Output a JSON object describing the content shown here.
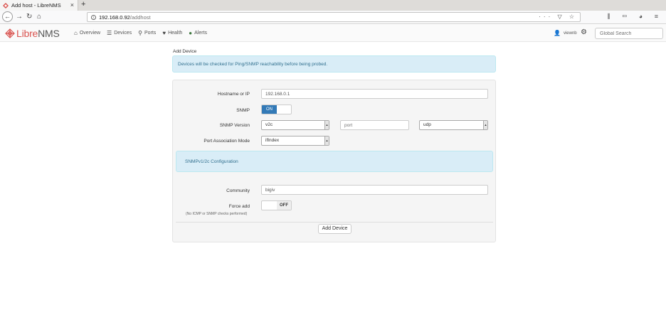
{
  "browser": {
    "tab_title": "Add host - LibreNMS",
    "url_host": "192.168.0.92",
    "url_path": "/addhost",
    "new_tab": "+",
    "url_actions": "··· ▽ ☆",
    "toolbar_icons": "⫼ ▭ ◕ ≡"
  },
  "app": {
    "logo_text": "Libre",
    "logo_text_2": "NMS",
    "menu": [
      {
        "label": "Overview",
        "icon": "home-icon"
      },
      {
        "label": "Devices",
        "icon": "server-icon"
      },
      {
        "label": "Ports",
        "icon": "link-icon"
      },
      {
        "label": "Health",
        "icon": "heartbeat-icon"
      },
      {
        "label": "Alerts",
        "icon": "exclamation-circle-icon"
      }
    ],
    "user": "viewnb",
    "search_placeholder": "Global Search"
  },
  "page": {
    "title": "Add Device",
    "notice": "Devices will be checked for Ping/SNMP reachability before being probed."
  },
  "form": {
    "hostname_label": "Hostname or IP",
    "hostname_value": "192.168.0.1",
    "snmp_label": "SNMP",
    "snmp_toggle": "ON",
    "snmp_version_label": "SNMP Version",
    "snmp_version_value": "v2c",
    "port_placeholder": "port",
    "transport_value": "udp",
    "port_assoc_label": "Port Association Mode",
    "port_assoc_value": "ifIndex",
    "config_heading": "SNMPv1/2c Configuration",
    "community_label": "Community",
    "community_value": "bigiv",
    "force_add_label": "Force add",
    "force_add_toggle": "OFF",
    "force_add_hint": "(No ICMP or SNMP checks performed)",
    "submit_label": "Add Device"
  },
  "colors": {
    "brand": "#d9534f",
    "primary": "#337ab7",
    "info_bg": "#d9edf7",
    "info_text": "#31708f"
  }
}
